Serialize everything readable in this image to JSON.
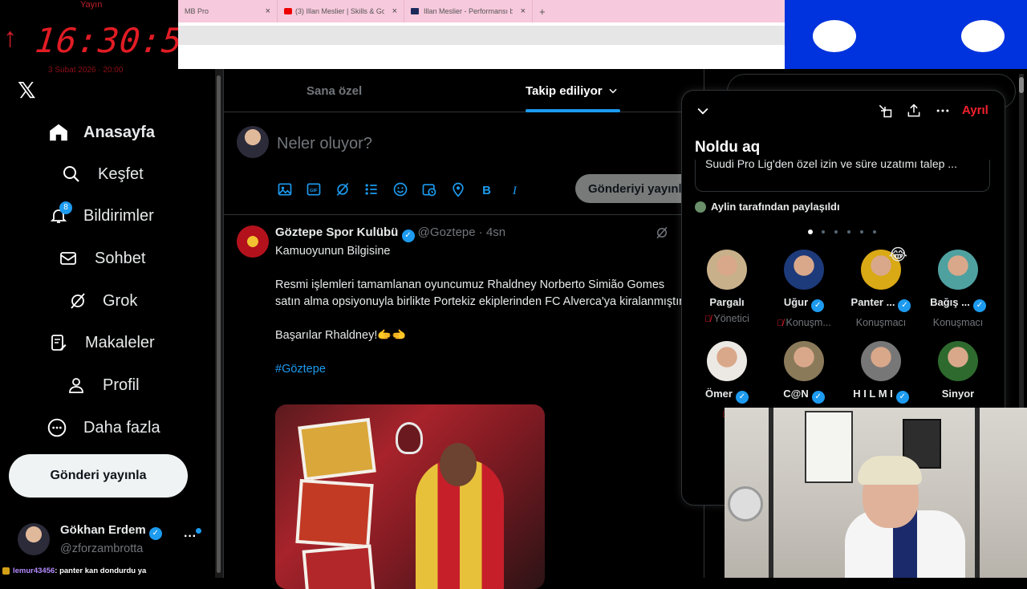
{
  "overlay": {
    "label": "Yayın",
    "clock": "16:30:56",
    "date": "3 Şubat 2026 · 20:00"
  },
  "browser": {
    "tabs": [
      {
        "title": "MB Pro",
        "close": "×"
      },
      {
        "title": "(3) Illan Meslier | Skills & Goalk...",
        "close": "×"
      },
      {
        "title": "Illan Meslier - Performansı bilgi...",
        "close": "×"
      }
    ],
    "new_tab": "+"
  },
  "sidebar": {
    "logo": "𝕏",
    "items": [
      {
        "label": "Anasayfa",
        "icon": "home-icon",
        "active": true
      },
      {
        "label": "Keşfet",
        "icon": "search-icon"
      },
      {
        "label": "Bildirimler",
        "icon": "bell-icon",
        "badge": "8"
      },
      {
        "label": "Sohbet",
        "icon": "mail-icon"
      },
      {
        "label": "Grok",
        "icon": "grok-icon"
      },
      {
        "label": "Makaleler",
        "icon": "articles-icon"
      },
      {
        "label": "Profil",
        "icon": "person-icon"
      },
      {
        "label": "Daha fazla",
        "icon": "more-circle-icon"
      }
    ],
    "post_button": "Gönderi yayınla",
    "account": {
      "name": "Gökhan Erdem",
      "handle": "@zforzambrotta",
      "more": "···"
    }
  },
  "main": {
    "tabs": [
      {
        "label": "Sana özel",
        "active": false
      },
      {
        "label": "Takip ediliyor",
        "active": true
      }
    ],
    "compose": {
      "placeholder": "Neler oluyor?",
      "post_button": "Gönderiyi yayınla",
      "tools": [
        "image-icon",
        "gif-icon",
        "grok-icon",
        "poll-icon",
        "emoji-icon",
        "schedule-icon",
        "location-icon",
        "bold-icon",
        "italic-icon"
      ]
    },
    "tweet": {
      "author": "Göztepe Spor Kulübü",
      "handle": "@Goztepe",
      "time": "· 4sn",
      "line1": "Kamuoyunun Bilgisine",
      "line2": "Resmi işlemleri tamamlanan oyuncumuz Rhaldney Norberto Simião Gomes satın alma opsiyonuyla birlikte Portekiz ekiplerinden FC Alverca'ya kiralanmıştır.",
      "line3": "Başarılar Rhaldney!🫱🫲",
      "hashtag": "#Göztepe"
    }
  },
  "spaces": {
    "leave": "Ayrıl",
    "title": "Noldu aq",
    "shared_tweet": "Suudi Pro Lig'den özel izin ve süre uzatımı talep ...",
    "shared_by": "Aylin tarafından paylaşıldı",
    "dots": 6,
    "participants": [
      {
        "name": "Pargalı",
        "role": "Yönetici",
        "muted": true,
        "verified": false,
        "color": "#c8b08a"
      },
      {
        "name": "Uğur",
        "role": "Konuşm...",
        "muted": true,
        "verified": true,
        "color": "#1d3a7a"
      },
      {
        "name": "Panter ...",
        "role": "Konuşmacı",
        "muted": false,
        "verified": true,
        "color": "#d9a916",
        "reaction": "😂"
      },
      {
        "name": "Bağış ...",
        "role": "Konuşmacı",
        "muted": false,
        "verified": true,
        "color": "#4fa1a0"
      },
      {
        "name": "Ömer",
        "role": "",
        "muted": true,
        "verified": true,
        "color": "#ece9e4"
      },
      {
        "name": "C@N",
        "role": "",
        "muted": false,
        "verified": true,
        "color": "#8a7a5a"
      },
      {
        "name": "H I L M I",
        "role": "",
        "muted": false,
        "verified": true,
        "color": "#777"
      },
      {
        "name": "Sinyor",
        "role": "",
        "muted": false,
        "verified": false,
        "color": "#2e6a2e"
      }
    ]
  },
  "chat": {
    "user": "lemur43456",
    "message": ": panter kan dondurdu ya"
  }
}
